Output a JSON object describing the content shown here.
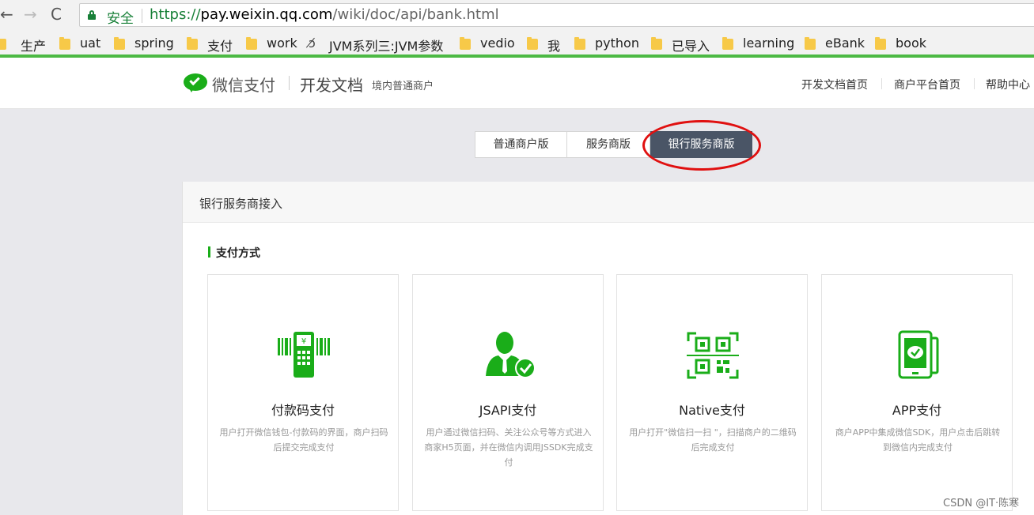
{
  "browser": {
    "nav": {
      "back": "←",
      "forward": "→",
      "reload": "C"
    },
    "secure_label": "安全",
    "url": {
      "scheme": "https://",
      "host": "pay.weixin.qq.com",
      "path": "/wiki/doc/api/bank.html"
    },
    "bookmarks": [
      {
        "label": "生产"
      },
      {
        "label": "uat"
      },
      {
        "label": "spring"
      },
      {
        "label": "支付"
      },
      {
        "label": "work"
      },
      {
        "label": "JVM系列三:JVM参数"
      },
      {
        "label": "vedio"
      },
      {
        "label": "我"
      },
      {
        "label": "python"
      },
      {
        "label": "已导入"
      },
      {
        "label": "learning"
      },
      {
        "label": "eBank"
      },
      {
        "label": "book"
      }
    ]
  },
  "header": {
    "brand": "微信支付",
    "doc_title": "开发文档",
    "doc_sub": "境内普通商户",
    "nav": [
      "开发文档首页",
      "商户平台首页",
      "帮助中心"
    ]
  },
  "tabs": [
    {
      "label": "普通商户版",
      "active": false
    },
    {
      "label": "服务商版",
      "active": false
    },
    {
      "label": "银行服务商版",
      "active": true
    }
  ],
  "main": {
    "card_title": "银行服务商接入",
    "section_title": "支付方式",
    "pay_methods": [
      {
        "icon": "pos-terminal-icon",
        "title": "付款码支付",
        "desc": "用户打开微信钱包-付款码的界面，商户扫码后提交完成支付"
      },
      {
        "icon": "user-verified-icon",
        "title": "JSAPI支付",
        "desc": "用户通过微信扫码、关注公众号等方式进入商家H5页面，并在微信内调用JSSDK完成支付"
      },
      {
        "icon": "qr-code-icon",
        "title": "Native支付",
        "desc": "用户打开\"微信扫一扫 \"，扫描商户的二维码后完成支付"
      },
      {
        "icon": "phone-wechat-icon",
        "title": "APP支付",
        "desc": "商户APP中集成微信SDK，用户点击后跳转到微信内完成支付"
      }
    ]
  },
  "watermark": "CSDN @IT·陈寒",
  "colors": {
    "brand_green": "#1aad19",
    "active_tab": "#4a5566",
    "annotation_red": "#e01010"
  }
}
